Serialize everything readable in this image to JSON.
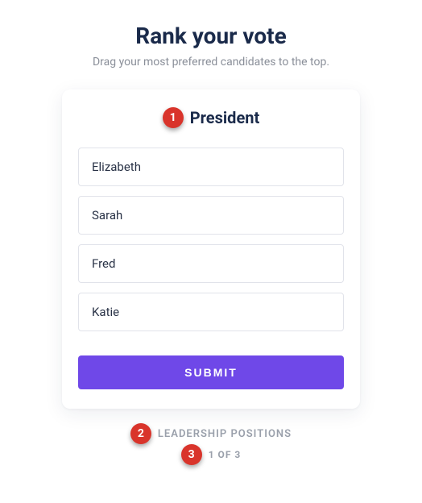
{
  "header": {
    "title": "Rank your vote",
    "subtitle": "Drag your most preferred candidates to the top."
  },
  "card": {
    "title": "President",
    "candidates": [
      "Elizabeth",
      "Sarah",
      "Fred",
      "Katie"
    ],
    "submit_label": "SUBMIT"
  },
  "footer": {
    "label": "LEADERSHIP POSITIONS",
    "progress": "1 OF 3"
  },
  "annotations": {
    "badge1": "1",
    "badge2": "2",
    "badge3": "3"
  },
  "colors": {
    "badge_bg": "#d9342b",
    "submit_bg": "#6f48e8",
    "title_color": "#1a2a4a",
    "muted": "#9aa0ab"
  }
}
